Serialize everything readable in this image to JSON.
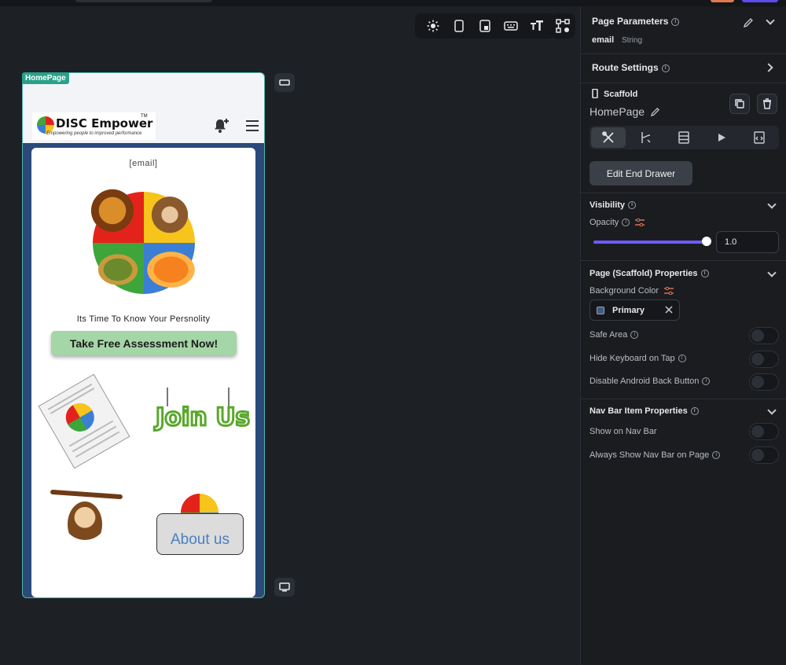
{
  "canvas": {
    "page_tag": "HomePage",
    "app": {
      "logo_text": "DISC Empower",
      "logo_tm": "TM",
      "logo_tagline": "Empowering people to improved performance",
      "email_placeholder": "[email]",
      "tagline": "Its Time To Know Your Persnolity",
      "cta_label": "Take Free Assessment Now!",
      "join_label": "Join Us",
      "about_label": "About us"
    }
  },
  "panel": {
    "page_params": {
      "title": "Page Parameters",
      "param_name": "email",
      "param_type": "String"
    },
    "route_settings": {
      "title": "Route Settings"
    },
    "scaffold": {
      "type_label": "Scaffold",
      "name": "HomePage",
      "edit_drawer_button": "Edit End Drawer"
    },
    "visibility": {
      "title": "Visibility",
      "opacity_label": "Opacity",
      "opacity_value": "1.0",
      "opacity_fraction": 1.0
    },
    "page_props": {
      "title": "Page (Scaffold) Properties",
      "bg_color_label": "Background Color",
      "bg_color_value": "Primary",
      "bg_color_hex": "#3b5a8a",
      "safe_area": "Safe Area",
      "hide_keyboard": "Hide Keyboard on Tap",
      "disable_back": "Disable Android Back Button"
    },
    "nav_bar": {
      "title": "Nav Bar Item Properties",
      "show_on_nav": "Show on Nav Bar",
      "always_show": "Always Show Nav Bar on Page"
    }
  },
  "colors": {
    "accent": "#6c5bff",
    "page_tag": "#2aa189",
    "cta": "#a5d6a7"
  }
}
